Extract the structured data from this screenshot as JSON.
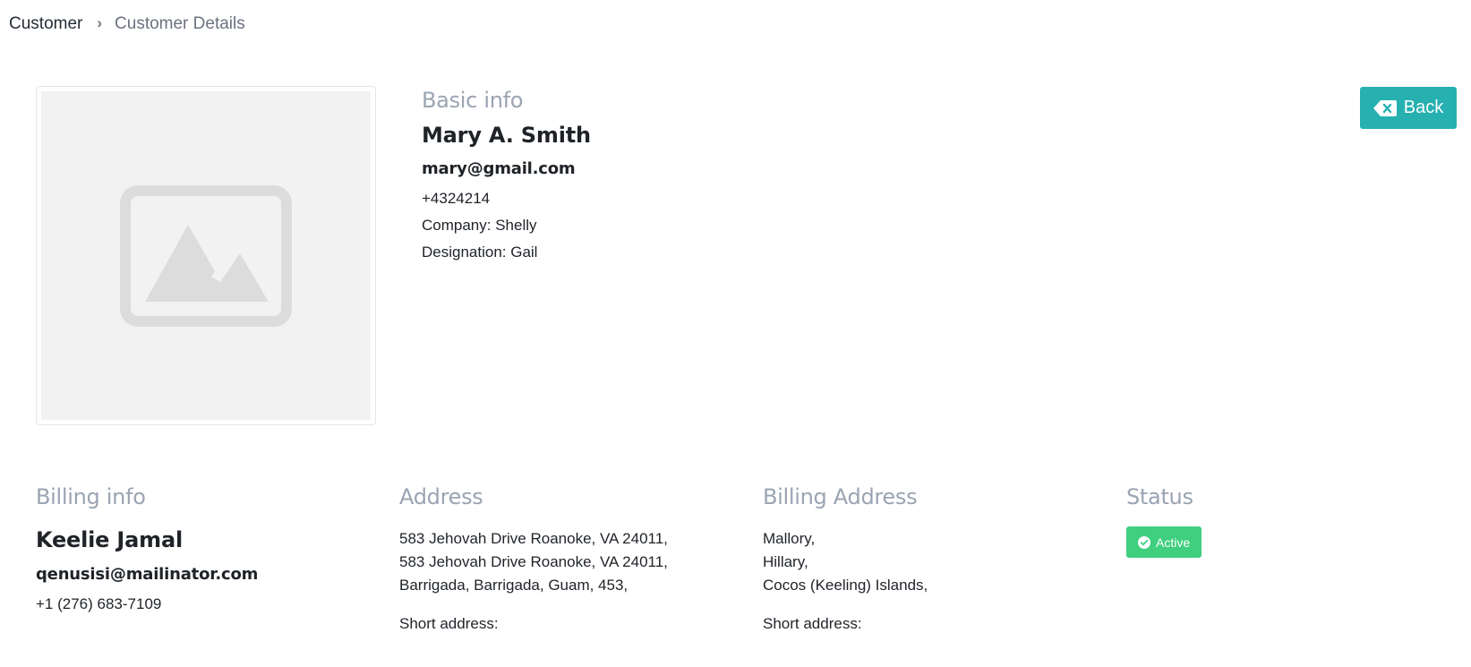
{
  "breadcrumb": {
    "root": "Customer",
    "current": "Customer Details"
  },
  "image": {
    "icon": "image-placeholder-icon"
  },
  "basic_info": {
    "heading": "Basic info",
    "name": "Mary A. Smith",
    "email": "mary@gmail.com",
    "phone": "+4324214",
    "company": "Company: Shelly",
    "designation": "Designation: Gail"
  },
  "back_button": {
    "label": "Back",
    "icon": "backspace-icon",
    "color": "#26b0b0"
  },
  "billing_info": {
    "heading": "Billing info",
    "name": "Keelie Jamal",
    "email": "qenusisi@mailinator.com",
    "phone": "+1 (276) 683-7109"
  },
  "address": {
    "heading": "Address",
    "lines": [
      "583 Jehovah Drive Roanoke, VA 24011,",
      "583 Jehovah Drive Roanoke, VA 24011,",
      "Barrigada, Barrigada, Guam, 453,"
    ],
    "short_address": "Short address:"
  },
  "billing_address": {
    "heading": "Billing Address",
    "lines": [
      "Mallory,",
      "Hillary,",
      "Cocos (Keeling) Islands,"
    ],
    "short_address": "Short address:"
  },
  "status": {
    "heading": "Status",
    "badge": "Active",
    "badge_icon": "check-circle-icon",
    "badge_color": "#3fcf7f"
  }
}
